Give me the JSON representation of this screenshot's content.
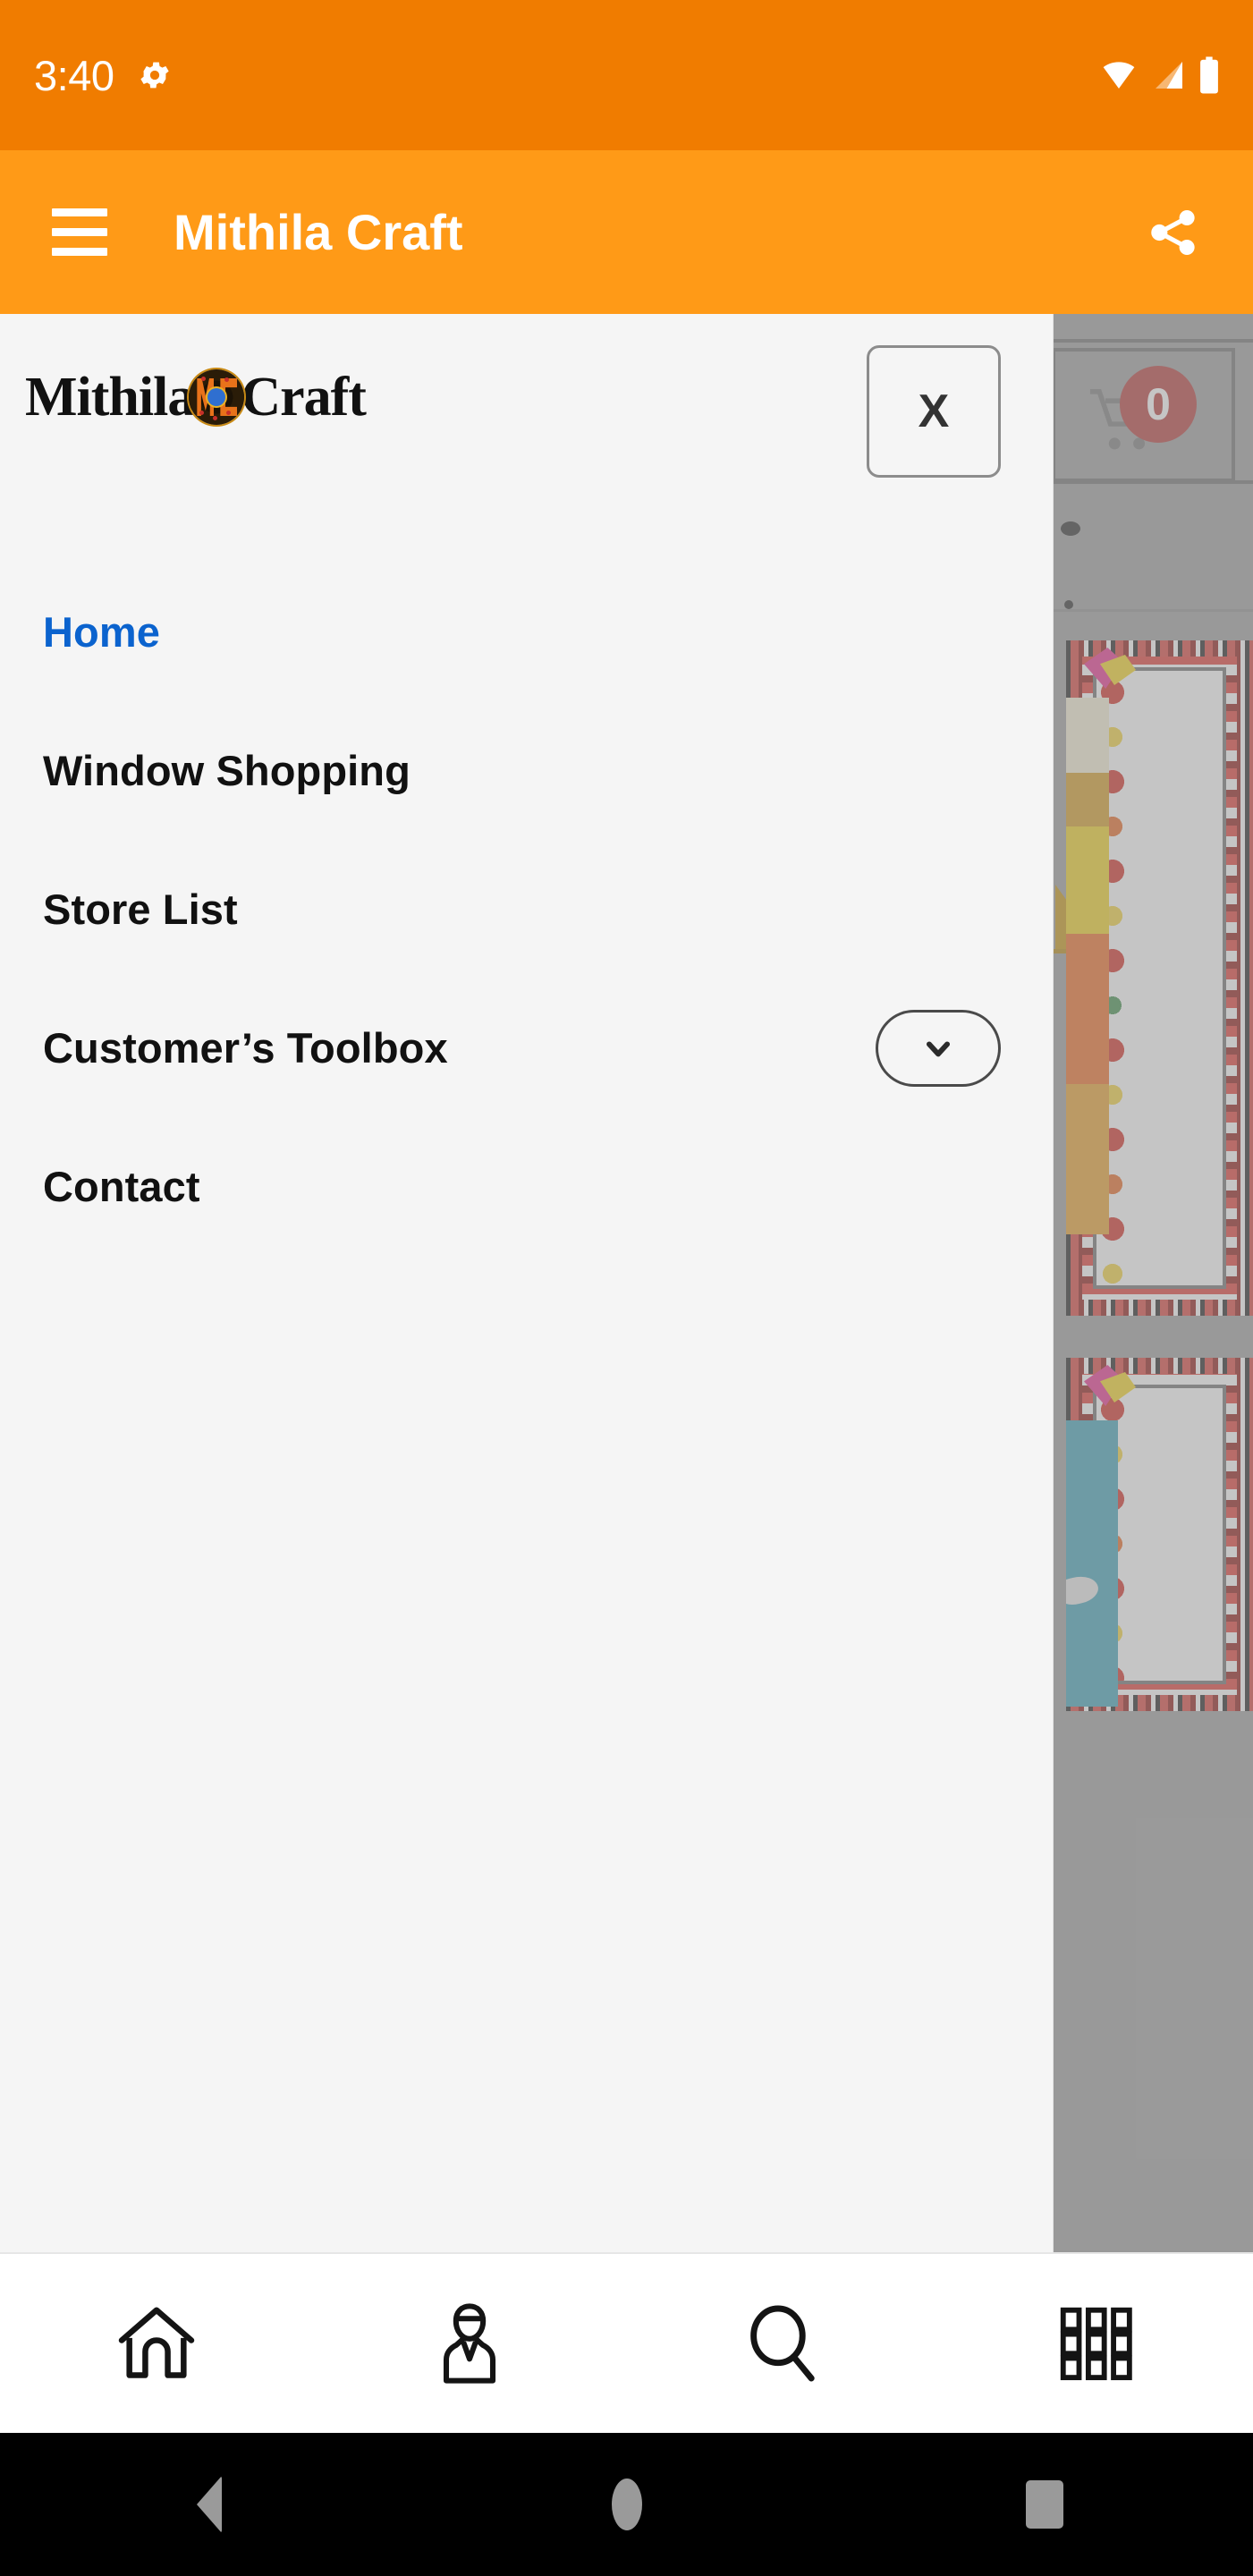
{
  "status_bar": {
    "time": "3:40",
    "gear_icon": "gear-icon",
    "wifi_icon": "wifi-icon",
    "signal_icon": "signal-bars-icon",
    "battery_icon": "battery-full-icon",
    "background_color": "#F07C00"
  },
  "app_bar": {
    "menu_icon": "hamburger-menu-icon",
    "title": "Mithila Craft",
    "share_icon": "share-icon",
    "background_color": "#FF9A17",
    "text_color": "#FFFFFF"
  },
  "drawer": {
    "logo": {
      "word_left": "Mithila",
      "word_right": "Craft",
      "emblem_letters": "MC"
    },
    "close_button_label": "X",
    "active_color": "#0B63CE",
    "background_color": "#F5F5F5",
    "items": [
      {
        "label": "Home",
        "active": true,
        "expandable": false
      },
      {
        "label": "Window Shopping",
        "active": false,
        "expandable": false
      },
      {
        "label": "Store List",
        "active": false,
        "expandable": false
      },
      {
        "label": "Customer’s Toolbox",
        "active": false,
        "expandable": true
      },
      {
        "label": "Contact",
        "active": false,
        "expandable": false
      }
    ]
  },
  "page_behind": {
    "cart_badge_count": "0",
    "cart_badge_color": "#B63A38",
    "cart_icon": "shopping-cart-icon",
    "overlay_color": "rgba(150,150,150,0.55)",
    "products": [
      {
        "name": "madhubani-painting-orange"
      },
      {
        "name": "madhubani-painting-teal"
      }
    ]
  },
  "bottom_tabs": [
    {
      "icon": "home-icon",
      "name": "tab-home"
    },
    {
      "icon": "account-person-icon",
      "name": "tab-account"
    },
    {
      "icon": "search-icon",
      "name": "tab-search"
    },
    {
      "icon": "grid-categories-icon",
      "name": "tab-categories"
    }
  ],
  "android_nav": [
    {
      "icon": "back-triangle-icon",
      "name": "android-back"
    },
    {
      "icon": "home-circle-icon",
      "name": "android-home"
    },
    {
      "icon": "recents-square-icon",
      "name": "android-recents"
    }
  ]
}
